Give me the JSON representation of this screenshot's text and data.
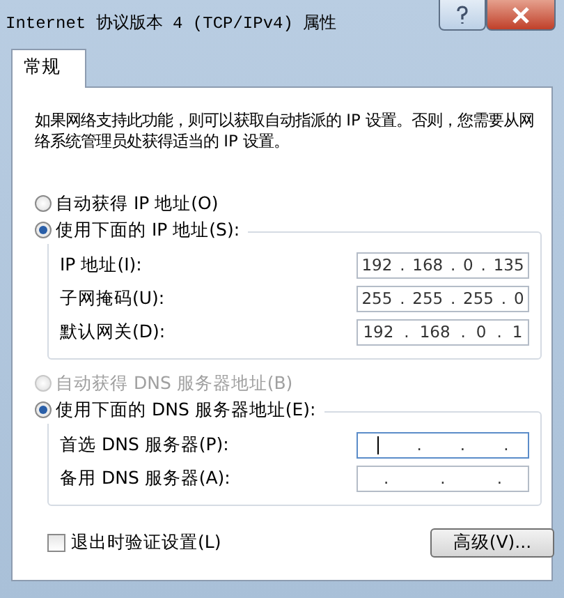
{
  "window": {
    "title": "Internet 协议版本 4 (TCP/IPv4) 属性"
  },
  "tabs": [
    {
      "label": "常规",
      "selected": true
    }
  ],
  "description": "如果网络支持此功能，则可以获取自动指派的 IP 设置。否则，您需要从网络系统管理员处获得适当的 IP 设置。",
  "ip_mode": [
    {
      "label": "自动获得 IP 地址(O)",
      "selected": false,
      "disabled": false
    },
    {
      "label": "使用下面的 IP 地址(S):",
      "selected": true,
      "disabled": false
    }
  ],
  "ip_fields": [
    {
      "label": "IP 地址(I):",
      "parts": [
        "192",
        ".",
        "168",
        ".",
        "0",
        ".",
        "135"
      ],
      "focused": false
    },
    {
      "label": "子网掩码(U):",
      "parts": [
        "255",
        ".",
        "255",
        ".",
        "255",
        ".",
        "0"
      ],
      "focused": false
    },
    {
      "label": "默认网关(D):",
      "parts": [
        "192",
        ".",
        "168",
        ".",
        "0",
        ".",
        "1"
      ],
      "focused": false
    }
  ],
  "dns_mode": [
    {
      "label": "自动获得 DNS 服务器地址(B)",
      "selected": false,
      "disabled": true
    },
    {
      "label": "使用下面的 DNS 服务器地址(E):",
      "selected": true,
      "disabled": false
    }
  ],
  "dns_fields": [
    {
      "label": "首选 DNS 服务器(P):",
      "parts": [
        ".",
        ".",
        "."
      ],
      "focused": true
    },
    {
      "label": "备用 DNS 服务器(A):",
      "parts": [
        ".",
        ".",
        "."
      ],
      "focused": false
    }
  ],
  "validate": {
    "label": "退出时验证设置(L)",
    "checked": false
  },
  "advanced_button": "高级(V)..."
}
